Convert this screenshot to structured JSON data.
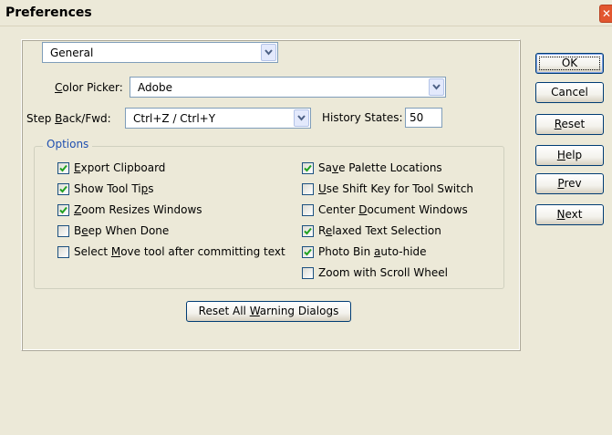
{
  "window": {
    "title": "Preferences",
    "close_glyph": "✕"
  },
  "section_select": {
    "value": "General"
  },
  "color_picker": {
    "label_pre": "",
    "label_u": "C",
    "label_post": "olor Picker:",
    "value": "Adobe"
  },
  "step_back": {
    "label_pre": "Step ",
    "label_u": "B",
    "label_post": "ack/Fwd:",
    "value": "Ctrl+Z / Ctrl+Y"
  },
  "history_states": {
    "label": "History States:",
    "value": "50"
  },
  "options": {
    "legend": "Options",
    "left": [
      {
        "pre": "",
        "u": "E",
        "post": "xport Clipboard",
        "checked": true
      },
      {
        "pre": "Show Tool Ti",
        "u": "p",
        "post": "s",
        "checked": true
      },
      {
        "pre": "",
        "u": "Z",
        "post": "oom Resizes Windows",
        "checked": true
      },
      {
        "pre": "B",
        "u": "e",
        "post": "ep When Done",
        "checked": false
      },
      {
        "pre": "Select ",
        "u": "M",
        "post": "ove tool after committing text",
        "checked": false
      }
    ],
    "right": [
      {
        "pre": "Sa",
        "u": "v",
        "post": "e Palette Locations",
        "checked": true
      },
      {
        "pre": "",
        "u": "U",
        "post": "se Shift Key for Tool Switch",
        "checked": false
      },
      {
        "pre": "Center ",
        "u": "D",
        "post": "ocument Windows",
        "checked": false
      },
      {
        "pre": "R",
        "u": "e",
        "post": "laxed Text Selection",
        "checked": true
      },
      {
        "pre": "Photo Bin ",
        "u": "a",
        "post": "uto-hide",
        "checked": true
      },
      {
        "pre": "Zoom with Scroll Wheel",
        "u": "",
        "post": "",
        "checked": false
      }
    ]
  },
  "reset_warnings": {
    "pre": "Reset All ",
    "u": "W",
    "post": "arning Dialogs"
  },
  "buttons": {
    "ok": "OK",
    "cancel": "Cancel",
    "reset": {
      "u": "R",
      "post": "eset"
    },
    "help": {
      "u": "H",
      "post": "elp"
    },
    "prev": {
      "u": "P",
      "post": "rev"
    },
    "next": {
      "u": "N",
      "post": "ext"
    }
  },
  "icons": {
    "dropdown": "chevron-down-icon",
    "check": "checkmark-icon",
    "close": "close-icon"
  },
  "colors": {
    "window_bg": "#ece9d8",
    "group_legend": "#1f4fb0",
    "checkbox_border": "#1c5180",
    "check_mark": "#21a121",
    "close_red": "#e2562f"
  }
}
